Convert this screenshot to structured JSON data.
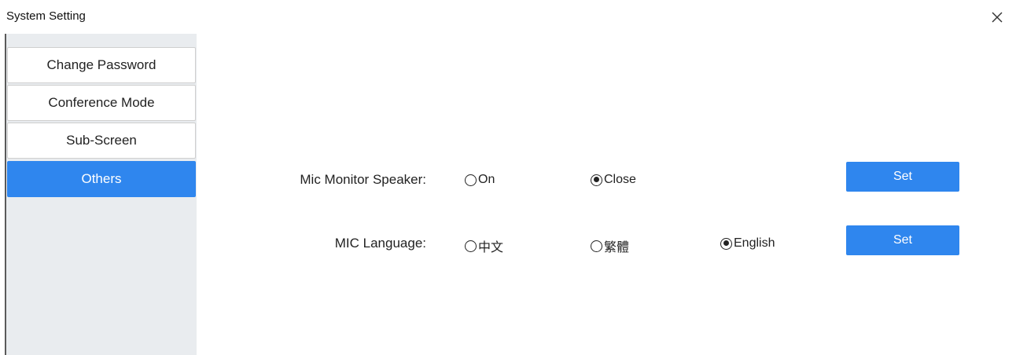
{
  "window": {
    "title": "System Setting",
    "close_label": "✕"
  },
  "sidebar": {
    "items": [
      {
        "label": "Change Password",
        "active": false
      },
      {
        "label": "Conference Mode",
        "active": false
      },
      {
        "label": "Sub-Screen",
        "active": false
      },
      {
        "label": "Others",
        "active": true
      }
    ]
  },
  "settings": {
    "mic_monitor": {
      "label": "Mic Monitor Speaker:",
      "options": [
        {
          "label": "On",
          "checked": false
        },
        {
          "label": "Close",
          "checked": true
        }
      ],
      "set_label": "Set"
    },
    "mic_language": {
      "label": "MIC Language:",
      "options": [
        {
          "label": "中文",
          "checked": false
        },
        {
          "label": "繁體",
          "checked": false
        },
        {
          "label": "English",
          "checked": true
        }
      ],
      "set_label": "Set"
    }
  },
  "colors": {
    "accent": "#2f86ee",
    "sidebar_bg": "#e9ecef"
  }
}
